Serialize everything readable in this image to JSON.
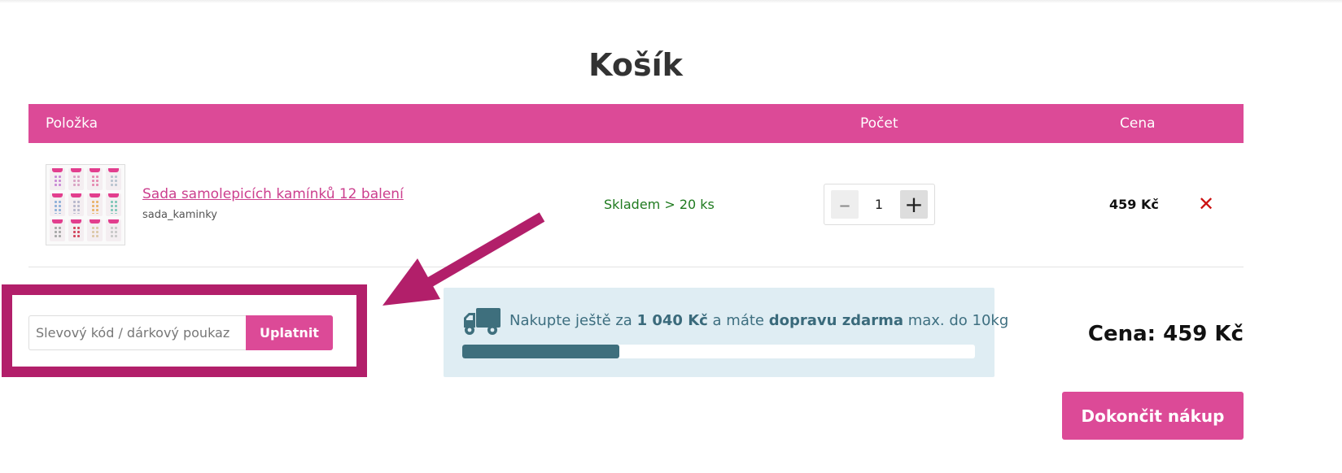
{
  "page": {
    "title": "Košík"
  },
  "table": {
    "headers": {
      "item": "Položka",
      "quantity": "Počet",
      "price": "Cena"
    }
  },
  "cart_items": [
    {
      "name": "Sada samolepicích kamínků 12 balení",
      "code": "sada_kaminky",
      "stock": "Skladem > 20 ks",
      "quantity": "1",
      "price": "459 Kč"
    }
  ],
  "qty_controls": {
    "minus": "–",
    "plus": "+"
  },
  "remove_symbol": "✕",
  "coupon": {
    "placeholder": "Slevový kód / dárkový poukaz",
    "button": "Uplatnit"
  },
  "shipping": {
    "text_before": "Nakupte ještě za ",
    "amount": "1 040 Kč",
    "text_middle": " a máte ",
    "free_shipping": "dopravu zdarma",
    "text_after": " max. do 10kg",
    "progress_fraction": 0.306
  },
  "summary": {
    "total": "Cena: 459 Kč",
    "checkout_button": "Dokončit nákup"
  },
  "colors": {
    "accent": "#dc4a97",
    "annotation": "#b21f6a",
    "shipping_bg": "#dfedf3",
    "shipping_fg": "#3e6f7d",
    "stock_green": "#1f7a1f",
    "remove_red": "#cc1111"
  },
  "icons": {
    "truck": "truck-icon",
    "remove": "close-icon"
  }
}
